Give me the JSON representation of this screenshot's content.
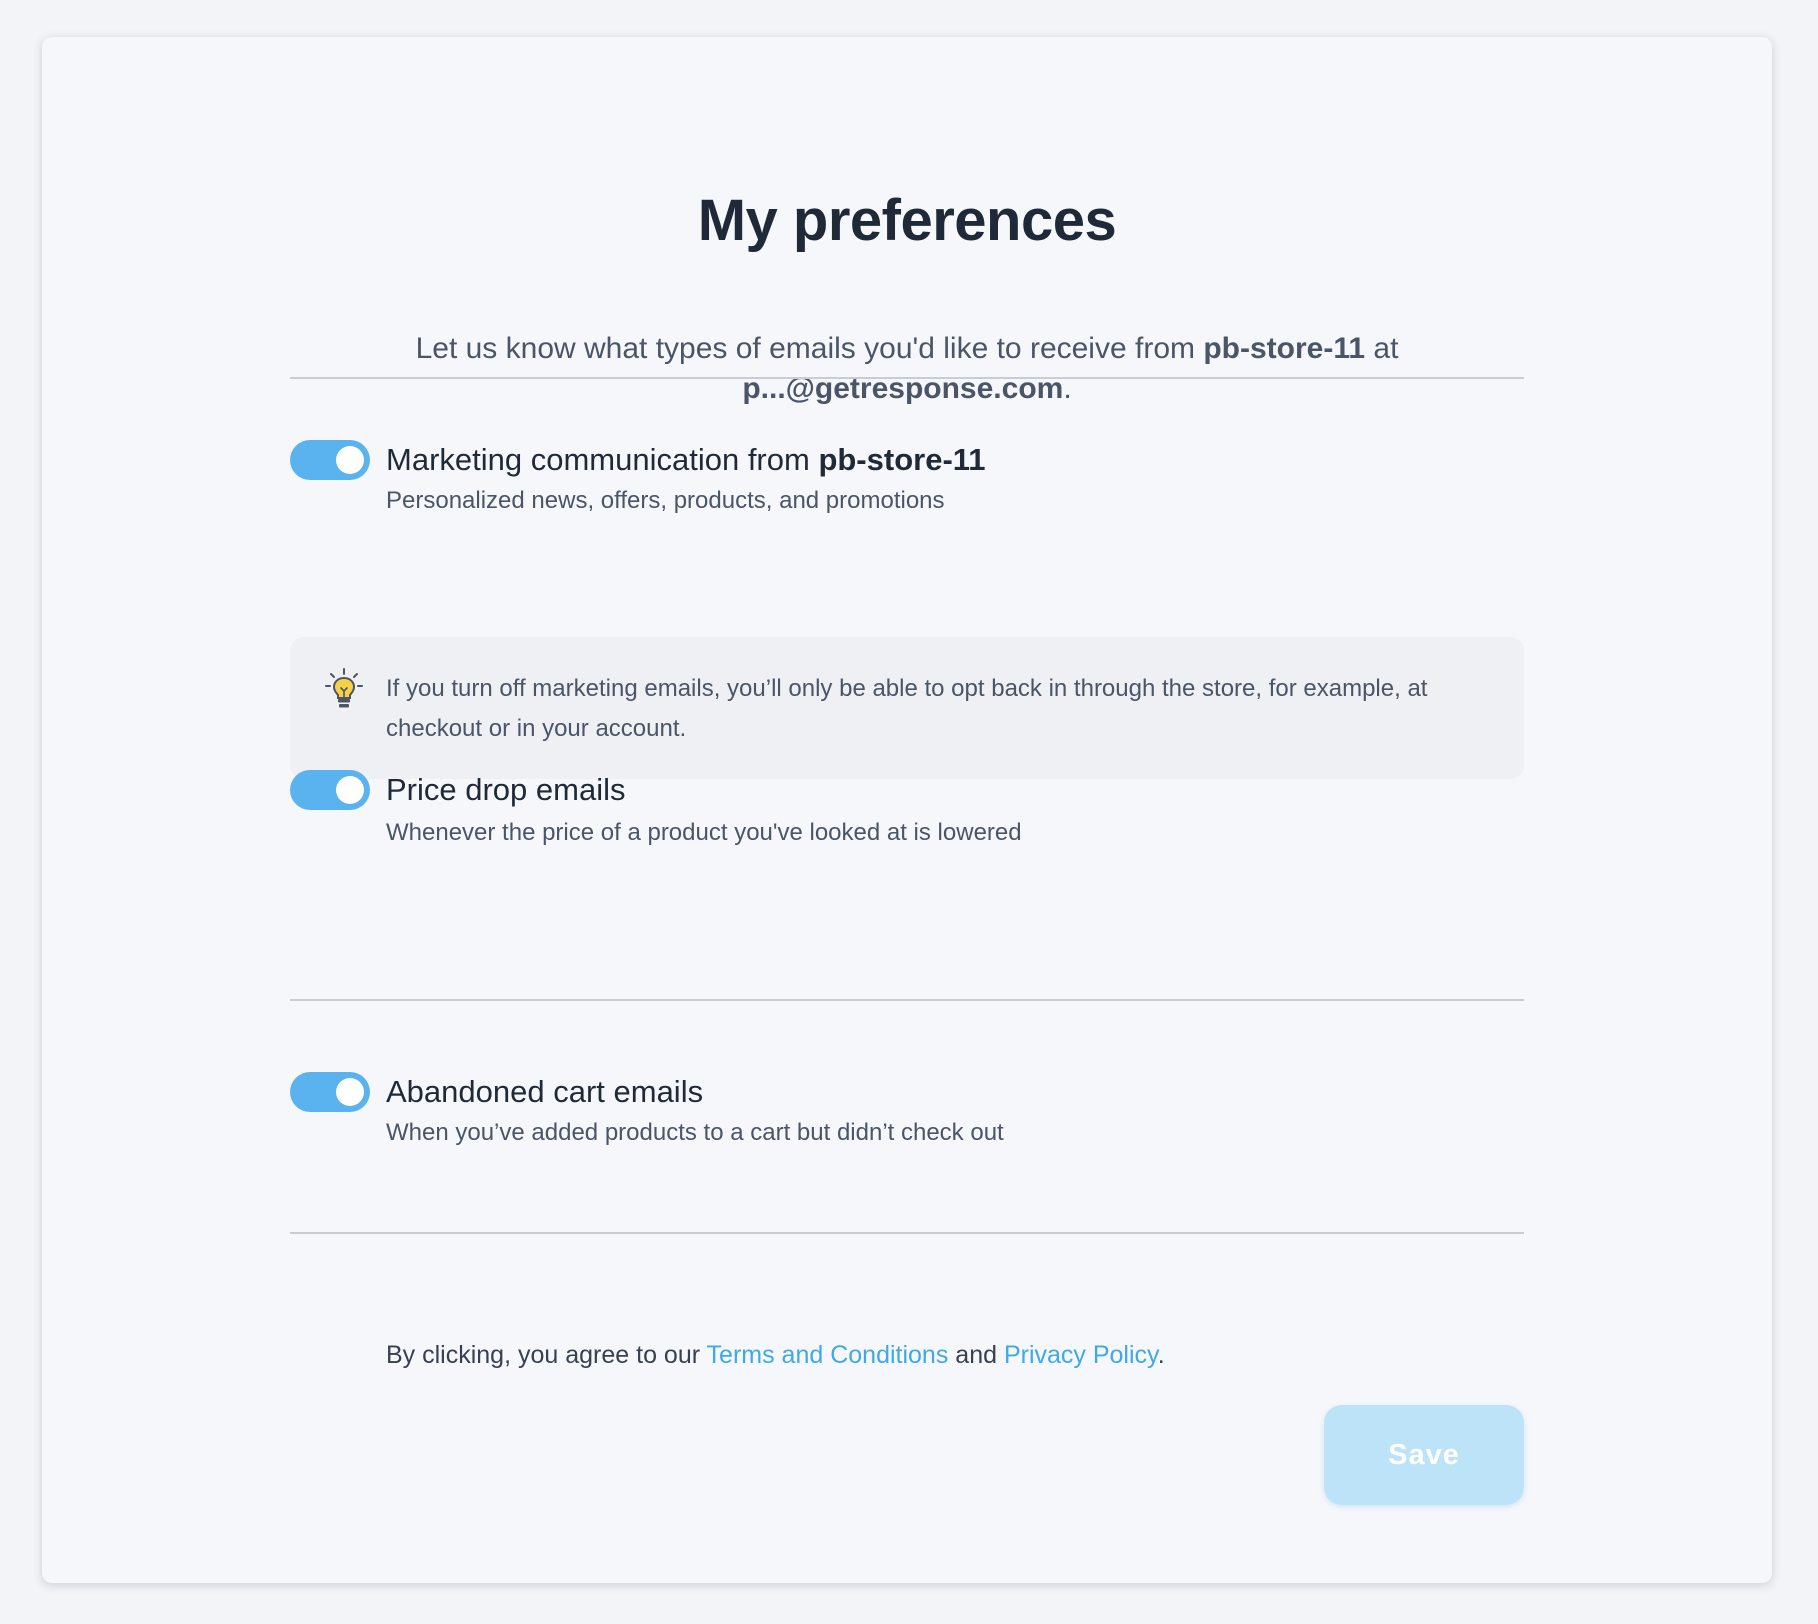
{
  "page": {
    "title": "My preferences"
  },
  "intro": {
    "text_before": "Let us know what types of emails you'd like to receive from ",
    "store_name": "pb-store-11",
    "text_middle": " at ",
    "email": "p...@getresponse.com",
    "text_after": "."
  },
  "options": [
    {
      "label": "Marketing communication from ",
      "label_bold": "pb-store-11",
      "description": "Personalized news, offers, products, and promotions",
      "enabled": true
    },
    {
      "label": "Price drop emails",
      "description": "Whenever the price of a product you've looked at is lowered",
      "enabled": true
    },
    {
      "label": "Abandoned cart emails",
      "description": "When you’ve added products to a cart but didn’t check out",
      "enabled": true
    }
  ],
  "notice": {
    "icon": "lightbulb-icon",
    "text": "If you turn off marketing emails, you’ll only be able to opt back in through the store, for example, at checkout or in your account."
  },
  "consent": {
    "text_before": "By clicking, you agree to our ",
    "terms_link": "Terms and Conditions",
    "text_middle": " and ",
    "privacy_link": "Privacy Policy",
    "text_after": "."
  },
  "actions": {
    "save_label": "Save"
  },
  "colors": {
    "toggle_on": "#5ab2ee",
    "link": "#3fa9e8",
    "save_disabled": "#bde3f8",
    "heading": "#1f2937",
    "body_text": "#4a5568"
  }
}
